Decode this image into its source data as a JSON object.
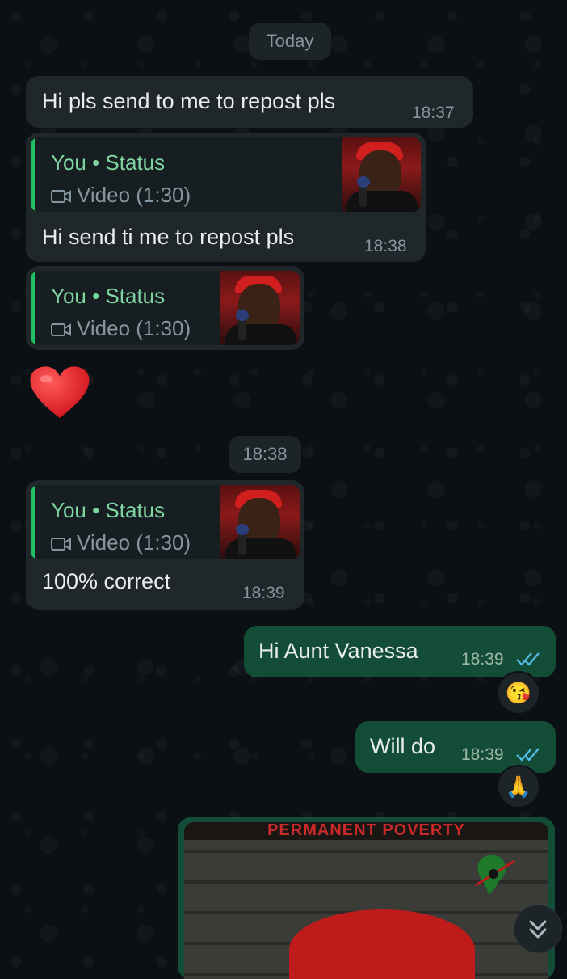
{
  "chat": {
    "date_divider": "Today",
    "messages": [
      {
        "direction": "in",
        "text": "Hi pls send to me to repost pls",
        "time": "18:37"
      },
      {
        "direction": "in",
        "quote": {
          "title": "You • Status",
          "subtitle": "Video (1:30)"
        },
        "text": "Hi send ti me to repost pls",
        "time": "18:38"
      },
      {
        "direction": "in",
        "quote": {
          "title": "You • Status",
          "subtitle": "Video (1:30)"
        }
      },
      {
        "direction": "in",
        "emoji": "heart"
      },
      {
        "direction": "in",
        "quote": {
          "title": "You • Status",
          "subtitle": "Video (1:30)"
        },
        "text": "100% correct",
        "time": "18:39"
      },
      {
        "direction": "out",
        "text": "Hi Aunt Vanessa",
        "time": "18:39",
        "status": "read",
        "reaction": "😘"
      },
      {
        "direction": "out",
        "text": "Will do",
        "time": "18:39",
        "status": "read",
        "reaction": "🙏"
      },
      {
        "direction": "out",
        "media": {
          "type": "image",
          "caption_banner": "PERMANENT POVERTY"
        }
      }
    ],
    "time_divider": "18:38",
    "scroll_button_icon": "double-chevron-down-icon"
  },
  "colors": {
    "background": "#0b1014",
    "incoming_bubble": "#1f272a",
    "outgoing_bubble": "#144d37",
    "accent_green": "#21c063",
    "read_ticks": "#53bdeb"
  }
}
